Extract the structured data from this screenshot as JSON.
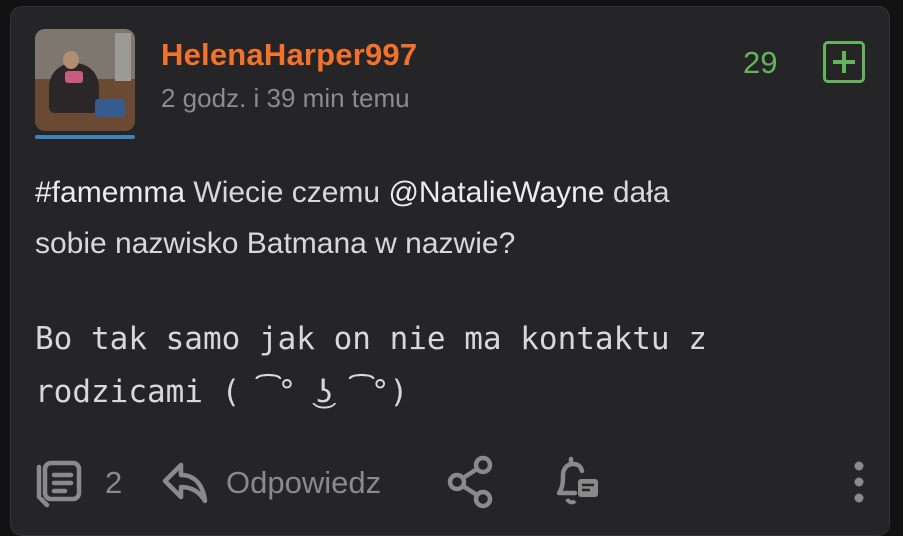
{
  "post": {
    "author": "HelenaHarper997",
    "time_ago": "2 godz. i 39 min temu",
    "votes": "29",
    "tag": "#famemma",
    "line1_middle": " Wiecie czemu ",
    "mention": "@NatalieWayne",
    "line1_end": " dała",
    "line2": "sobie nazwisko Batmana w nazwie?",
    "code_line1": "Bo tak samo jak on nie ma kontaktu z",
    "code_line2": "rodzicami ( ͡° ͜ʖ ͡°)"
  },
  "footer": {
    "comment_count": "2",
    "reply_label": "Odpowiedz"
  },
  "colors": {
    "author": "#f2722c",
    "vote": "#62b35a",
    "background": "#252527"
  },
  "icons": [
    "comments-icon",
    "reply-icon",
    "share-icon",
    "notification-icon",
    "more-vertical-icon",
    "plus-icon"
  ]
}
